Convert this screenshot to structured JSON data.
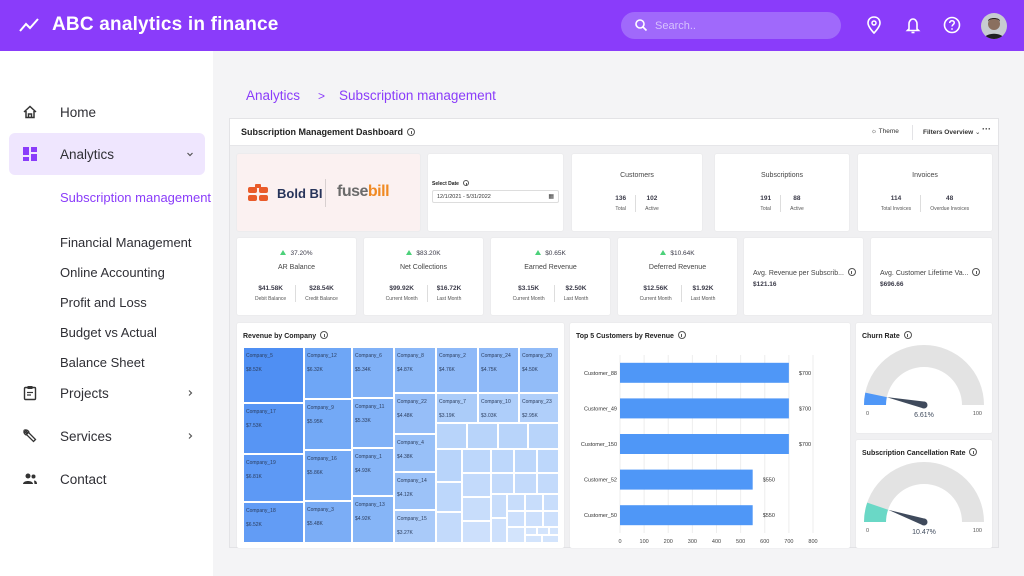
{
  "app": {
    "title": "ABC analytics in finance",
    "search_placeholder": "Search.."
  },
  "topbar_icons": [
    "location-pin-icon",
    "bell-icon",
    "help-icon"
  ],
  "sidebar": {
    "items": [
      {
        "label": "Home",
        "icon": "home-icon"
      },
      {
        "label": "Analytics",
        "icon": "dashboard-icon",
        "expanded": true
      },
      {
        "label": "Projects",
        "icon": "clipboard-icon"
      },
      {
        "label": "Services",
        "icon": "wrench-icon"
      },
      {
        "label": "Contact",
        "icon": "people-icon"
      }
    ],
    "analytics_subitems": [
      {
        "label": "Subscription management",
        "active": true
      },
      {
        "label": "Financial Management"
      },
      {
        "label": "Online Accounting"
      },
      {
        "label": "Profit and Loss"
      },
      {
        "label": "Budget vs Actual"
      },
      {
        "label": "Balance Sheet"
      }
    ]
  },
  "breadcrumb": {
    "parent": "Analytics",
    "separator": ">",
    "current": "Subscription management"
  },
  "dashboard": {
    "title": "Subscription Management Dashboard",
    "theme_label": "Theme",
    "filters_label": "Filters Overview",
    "more_label": "···",
    "logos": {
      "boldbi": "Bold BI",
      "fusebill_a": "fuse",
      "fusebill_b": "bill"
    },
    "date_filter": {
      "label": "Select Date",
      "value": "12/1/2021 - 5/31/2022"
    },
    "summary": [
      {
        "title": "Customers",
        "a_val": "136",
        "a_lbl": "Total",
        "b_val": "102",
        "b_lbl": "Active"
      },
      {
        "title": "Subscriptions",
        "a_val": "191",
        "a_lbl": "Total",
        "b_val": "88",
        "b_lbl": "Active"
      },
      {
        "title": "Invoices",
        "a_val": "114",
        "a_lbl": "Total Invoices",
        "b_val": "48",
        "b_lbl": "Overdue Invoices"
      }
    ],
    "kpis": [
      {
        "delta": "37.20%",
        "title": "AR Balance",
        "a_val": "$41.58K",
        "a_lbl": "Debit Balance",
        "b_val": "$28.54K",
        "b_lbl": "Credit Balance"
      },
      {
        "delta": "$83.20K",
        "title": "Net Collections",
        "a_val": "$99.92K",
        "a_lbl": "Current Month",
        "b_val": "$16.72K",
        "b_lbl": "Last Month"
      },
      {
        "delta": "$0.65K",
        "title": "Earned Revenue",
        "a_val": "$3.15K",
        "a_lbl": "Current Month",
        "b_val": "$2.50K",
        "b_lbl": "Last Month"
      },
      {
        "delta": "$10.64K",
        "title": "Deferred Revenue",
        "a_val": "$12.56K",
        "a_lbl": "Current Month",
        "b_val": "$1.92K",
        "b_lbl": "Last Month"
      }
    ],
    "averages": [
      {
        "title": "Avg. Revenue per Subscrib...",
        "value": "$121.16"
      },
      {
        "title": "Avg. Customer Lifetime Va...",
        "value": "$696.66"
      }
    ],
    "colors": {
      "accent": "#8a3cfa",
      "bar": "#4f97f7",
      "churn": "#4f97f7",
      "cancel": "#6ad8c6",
      "kpi_up": "#4cd17a"
    }
  },
  "chart_data": [
    {
      "type": "treemap",
      "title": "Revenue by Company",
      "labeled": [
        {
          "name": "Company_5",
          "value": "$8.52K"
        },
        {
          "name": "Company_17",
          "value": "$7.53K"
        },
        {
          "name": "Company_19",
          "value": "$6.81K"
        },
        {
          "name": "Company_18",
          "value": "$6.52K"
        },
        {
          "name": "Company_12",
          "value": "$6.32K"
        },
        {
          "name": "Company_9",
          "value": "$5.95K"
        },
        {
          "name": "Company_16",
          "value": "$5.86K"
        },
        {
          "name": "Company_3",
          "value": "$5.48K"
        },
        {
          "name": "Company_6",
          "value": "$5.34K"
        },
        {
          "name": "Company_11",
          "value": "$5.33K"
        },
        {
          "name": "Company_1",
          "value": "$4.93K"
        },
        {
          "name": "Company_13",
          "value": "$4.92K"
        },
        {
          "name": "Company_8",
          "value": "$4.87K"
        },
        {
          "name": "Company_2",
          "value": "$4.76K"
        },
        {
          "name": "Company_24",
          "value": "$4.75K"
        },
        {
          "name": "Company_20",
          "value": "$4.50K"
        },
        {
          "name": "Company_22",
          "value": "$4.48K"
        },
        {
          "name": "Company_4",
          "value": "$4.38K"
        },
        {
          "name": "Company_14",
          "value": "$4.12K"
        },
        {
          "name": "Company_15",
          "value": "$3.27K"
        },
        {
          "name": "Company_7",
          "value": "$3.19K"
        },
        {
          "name": "Company_10",
          "value": "$3.03K"
        },
        {
          "name": "Company_23",
          "value": "$2.95K"
        }
      ]
    },
    {
      "type": "bar",
      "orientation": "horizontal",
      "title": "Top 5 Customers by Revenue",
      "categories": [
        "Customer_88",
        "Customer_49",
        "Customer_150",
        "Customer_52",
        "Customer_50"
      ],
      "values": [
        700,
        700,
        700,
        550,
        550
      ],
      "data_labels": [
        "$700",
        "$700",
        "$700",
        "$550",
        "$550"
      ],
      "xlim": [
        0,
        800
      ],
      "xticks": [
        "0",
        "100",
        "200",
        "300",
        "400",
        "500",
        "600",
        "700",
        "800"
      ],
      "grid": true
    },
    {
      "type": "gauge",
      "title": "Churn Rate",
      "value": 6.61,
      "value_label": "6.61%",
      "range": [
        0,
        100
      ],
      "min_label": "0",
      "max_label": "100"
    },
    {
      "type": "gauge",
      "title": "Subscription Cancellation Rate",
      "value": 10.47,
      "value_label": "10.47%",
      "range": [
        0,
        100
      ],
      "min_label": "0",
      "max_label": "100"
    }
  ]
}
